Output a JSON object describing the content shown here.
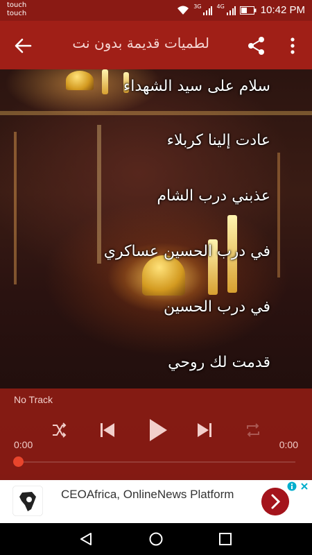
{
  "status_bar": {
    "left_line1": "touch",
    "left_line2": "touch",
    "network_1": "3G",
    "network_2": "4G",
    "time": "10:42 PM"
  },
  "app_bar": {
    "title": "لطميات قديمة بدون نت",
    "icons": [
      "back-arrow-icon",
      "share-icon",
      "more-vert-icon"
    ]
  },
  "playlist": {
    "items": [
      "سلام على سيد الشهداء",
      "عادت إلينا كربلاء",
      "عذبني درب الشام",
      "في درب الحسين عساكري",
      "في درب الحسين",
      "قدمت لك روحي"
    ]
  },
  "player": {
    "now_playing": "No Track",
    "elapsed": "0:00",
    "duration": "0:00",
    "progress": 0,
    "icons": [
      "shuffle-icon",
      "skip-previous-icon",
      "play-icon",
      "skip-next-icon",
      "repeat-icon"
    ]
  },
  "ad": {
    "text": "CEOAfrica, OnlineNews Platform",
    "accent": "#a4141c"
  },
  "colors": {
    "status_bar": "#8a1a14",
    "app_bar": "#a01f17",
    "player": "#8c1c14",
    "seek_thumb": "#e8452c"
  }
}
